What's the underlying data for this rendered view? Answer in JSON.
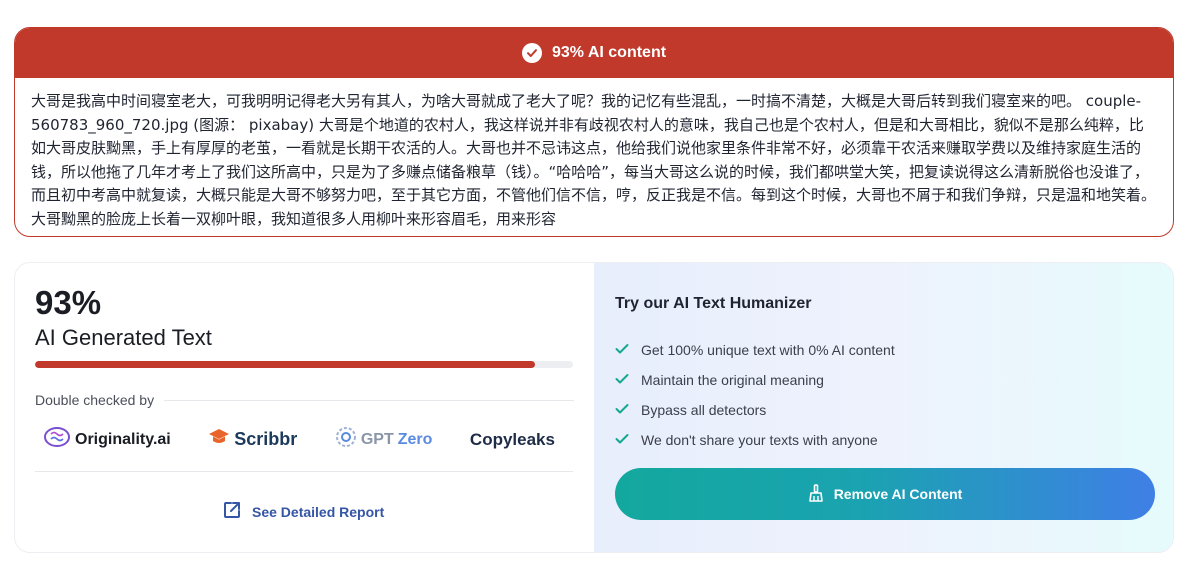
{
  "result": {
    "header_label": "93% AI content",
    "text": "大哥是我高中时间寝室老大，可我明明记得老大另有其人，为啥大哥就成了老大了呢？我的记忆有些混乱，一时搞不清楚，大概是大哥后转到我们寝室来的吧。 couple-560783_960_720.jpg (图源： pixabay) 大哥是个地道的农村人，我这样说并非有歧视农村人的意味，我自己也是个农村人，但是和大哥相比，貌似不是那么纯粹，比如大哥皮肤黝黑，手上有厚厚的老茧，一看就是长期干农活的人。大哥也并不忌讳这点，他给我们说他家里条件非常不好，必须靠干农活来赚取学费以及维持家庭生活的钱，所以他拖了几年才考上了我们这所高中，只是为了多赚点储备粮草（钱）。“哈哈哈”，每当大哥这么说的时候，我们都哄堂大笑，把复读说得这么清新脱俗也没谁了，而且初中考高中就复读，大概只能是大哥不够努力吧，至于其它方面，不管他们信不信，哼，反正我是不信。每到这个时候，大哥也不屑于和我们争辩，只是温和地笑着。大哥黝黑的脸庞上长着一双柳叶眼，我知道很多人用柳叶来形容眉毛，用来形容"
  },
  "score": {
    "percent_label": "93%",
    "percent_value": 93,
    "label": "AI Generated Text",
    "color": "#c0392b"
  },
  "double_checked": {
    "label": "Double checked by",
    "logos": {
      "originality": "Originality.ai",
      "scribbr": "Scribbr",
      "gpt": "GPT",
      "zero": "Zero",
      "copyleaks": "Copyleaks"
    }
  },
  "report_link": "See Detailed Report",
  "humanizer": {
    "title": "Try our AI Text Humanizer",
    "features": [
      "Get 100% unique text with 0% AI content",
      "Maintain the original meaning",
      "Bypass all detectors",
      "We don't share your texts with anyone"
    ],
    "button_label": "Remove AI Content",
    "accent": "#14a88f"
  }
}
